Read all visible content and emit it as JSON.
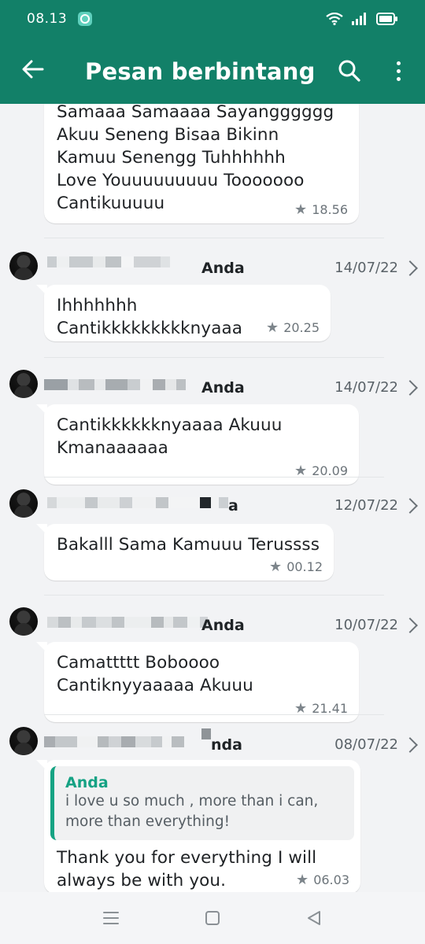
{
  "status": {
    "time": "08.13"
  },
  "header": {
    "title": "Pesan berbintang"
  },
  "messages": [
    {
      "text": "Samaaa Samaaaa Sayangggggg\nAkuu Seneng Bisaa Bikinn\nKamuu Senengg Tuhhhhhh\nLove Youuuuuuuuu Tooooooo\nCantikuuuuu",
      "time": "18.56"
    },
    {
      "sender": "Anda",
      "date": "14/07/22",
      "text": "Ihhhhhhh Cantikkkkkkkkknyaaa",
      "time": "20.25"
    },
    {
      "sender": "Anda",
      "date": "14/07/22",
      "text": "Cantikkkkkknyaaaa Akuuu\nKmanaaaaaa",
      "time": "20.09"
    },
    {
      "sender": "a",
      "date": "12/07/22",
      "text": "Bakalll Sama Kamuuu Terussss",
      "time": "00.12"
    },
    {
      "sender": "Anda",
      "date": "10/07/22",
      "text": "Camattttt Boboooo\nCantiknyyaaaaa Akuuu",
      "time": "21.41"
    },
    {
      "sender": "nda",
      "date": "08/07/22",
      "quote": {
        "name": "Anda",
        "text": "i love u so much , more than i can,\nmore than everything!"
      },
      "text": "Thank you for everything I will\nalways be with you.",
      "time": "06.03"
    }
  ],
  "icons": {
    "back": "back-arrow-icon",
    "search": "search-icon",
    "menu": "more-vert-icon",
    "star": "star-icon",
    "chevron": "chevron-right-icon"
  },
  "colors": {
    "header": "#128068",
    "accent": "#15a284",
    "background": "#f2f3f5"
  }
}
